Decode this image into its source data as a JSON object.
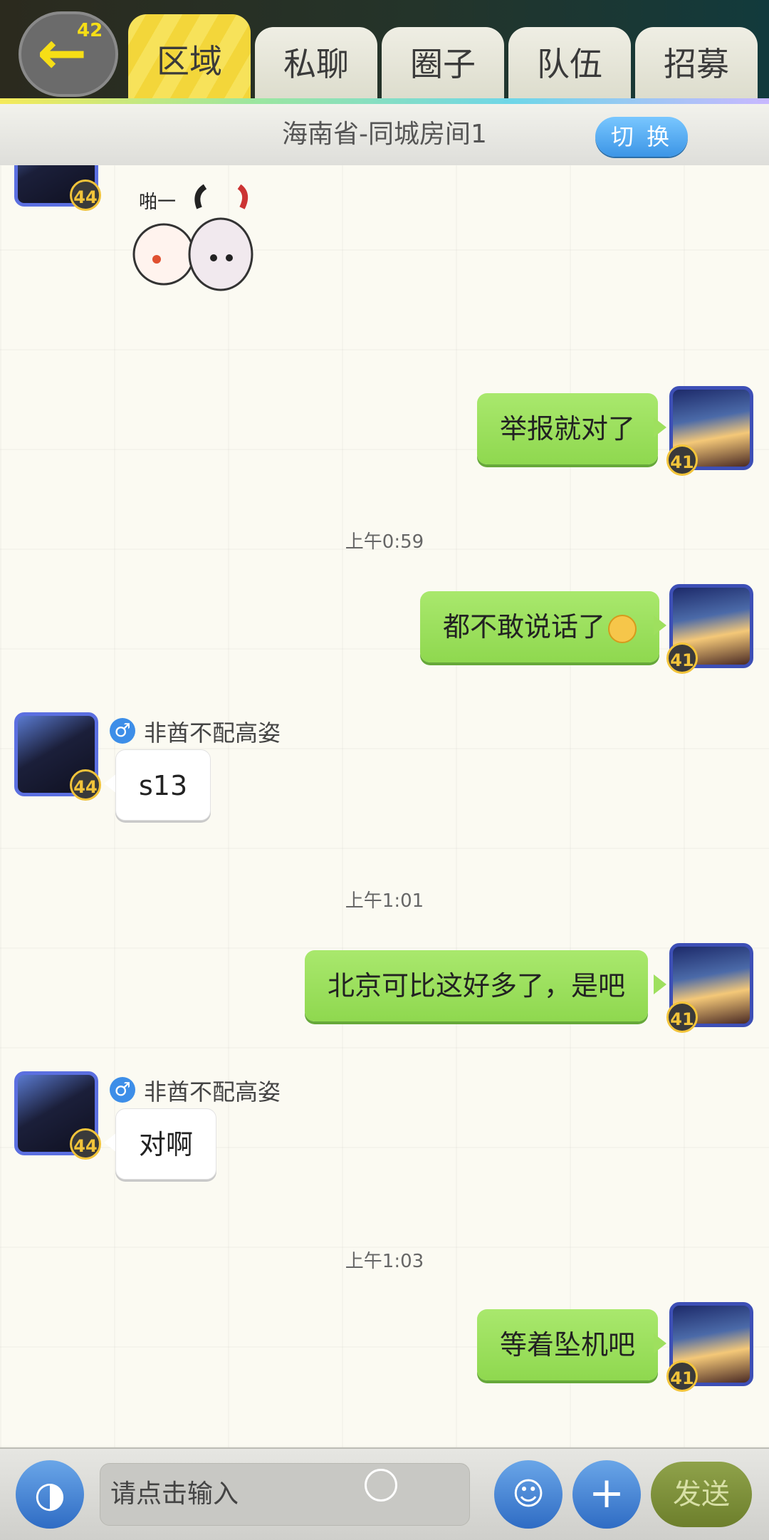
{
  "back": {
    "badge": "42"
  },
  "tabs": [
    {
      "label": "区域"
    },
    {
      "label": "私聊"
    },
    {
      "label": "圈子"
    },
    {
      "label": "队伍"
    },
    {
      "label": "招募"
    }
  ],
  "room": {
    "title": "海南省-同城房间1",
    "switch_label": "切 换"
  },
  "chat": {
    "sticker_text": "啪一",
    "top_avatar_level": "44",
    "messages": [
      {
        "side": "right",
        "text": "举报就对了",
        "level": "41"
      },
      {
        "timestamp": "上午0:59"
      },
      {
        "side": "right",
        "text": "都不敢说话了",
        "level": "41"
      },
      {
        "side": "left",
        "sender": "非酋不配高姿",
        "gender": "♂",
        "text": "s13",
        "level": "44"
      },
      {
        "timestamp": "上午1:01"
      },
      {
        "side": "right",
        "text": "北京可比这好多了，是吧",
        "level": "41"
      },
      {
        "side": "left",
        "sender": "非酋不配高姿",
        "gender": "♂",
        "text": "对啊",
        "level": "44"
      },
      {
        "timestamp": "上午1:03"
      },
      {
        "side": "right",
        "text": "等着坠机吧",
        "level": "41"
      }
    ]
  },
  "bottom": {
    "placeholder": "请点击输入",
    "send_label": "发送"
  }
}
